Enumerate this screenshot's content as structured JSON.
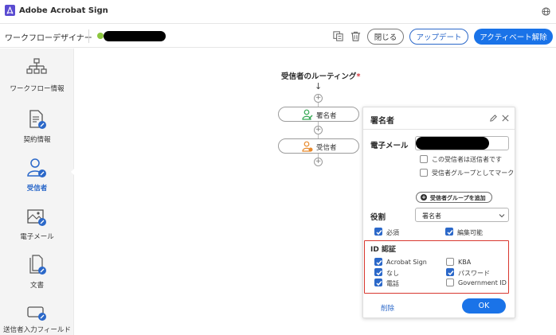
{
  "app": {
    "name": "Adobe Acrobat Sign",
    "logo_icon": "acrobat-sign-logo",
    "accent": "#1a73e8",
    "brand_color": "#5a4bd1"
  },
  "toolbar": {
    "title": "ワークフローデザイナー",
    "status_color": "#8cc63f",
    "close_label": "閉じる",
    "update_label": "アップデート",
    "deactivate_label": "アクティベート解除"
  },
  "sidebar": {
    "items": [
      {
        "label": "ワークフロー情報",
        "icon": "workflow-info-icon"
      },
      {
        "label": "契約情報",
        "icon": "document-info-icon"
      },
      {
        "label": "受信者",
        "icon": "recipients-icon",
        "active": true
      },
      {
        "label": "電子メール",
        "icon": "email-icon"
      },
      {
        "label": "文書",
        "icon": "documents-icon"
      },
      {
        "label": "送信者入力フィールド",
        "icon": "sender-fields-icon"
      }
    ]
  },
  "canvas": {
    "routing_title": "受信者のルーティング",
    "required_mark": "*",
    "arrow": "↓",
    "nodes": [
      {
        "label": "署名者",
        "icon": "signer-icon"
      },
      {
        "label": "受信者",
        "icon": "recipient-icon"
      }
    ]
  },
  "panel": {
    "title": "署名者",
    "email_label": "電子メール",
    "opt_sender": "この受信者は送信者です",
    "opt_group": "受信者グループとしてマーク",
    "add_group": "受信者グループを追加",
    "role_label": "役割",
    "role_value": "署名者",
    "required_label": "必須",
    "editable_label": "編集可能",
    "id_title": "ID 認証",
    "id_options": [
      {
        "label": "Acrobat Sign",
        "checked": true
      },
      {
        "label": "KBA",
        "checked": false
      },
      {
        "label": "なし",
        "checked": true
      },
      {
        "label": "パスワード",
        "checked": true
      },
      {
        "label": "電話",
        "checked": true
      },
      {
        "label": "Government ID",
        "checked": false
      }
    ],
    "delete_label": "削除",
    "ok_label": "OK"
  }
}
